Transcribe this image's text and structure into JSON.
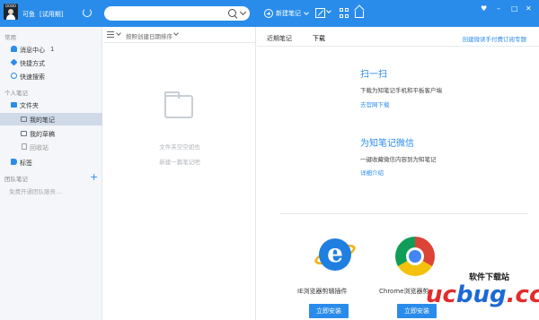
{
  "header": {
    "avatar_caption": "DOBO",
    "username": "可鱼",
    "trial_badge": "[试用期]",
    "search_value": "",
    "new_note_label": "新建笔记",
    "window_controls": [
      "♥",
      "–",
      "□",
      "✕"
    ]
  },
  "sidebar": {
    "section_common": "常用",
    "items_common": [
      {
        "label": "消息中心",
        "count": "1",
        "icon": "bell-icon"
      },
      {
        "label": "快捷方式",
        "icon": "link-icon"
      },
      {
        "label": "快速搜索",
        "icon": "search-icon"
      }
    ],
    "section_personal": "个人笔记",
    "folder_root": "文件夹",
    "folders": [
      {
        "label": "我的笔记",
        "active": true
      },
      {
        "label": "我的草稿",
        "active": false
      },
      {
        "label": "回收站",
        "active": false
      }
    ],
    "tags_label": "标签",
    "section_team": "团队笔记",
    "team_hint": "免费开通团队服务..."
  },
  "notelist": {
    "sort_label": "按照创建日期排序",
    "empty_line1": "文件夹空空如也",
    "empty_line2": "新建一篇笔记吧"
  },
  "main": {
    "tabs": [
      "近期笔记",
      "下载"
    ],
    "active_tab": "下载",
    "top_link": "创建微读手付费订阅专题",
    "scan_title": "扫一扫",
    "scan_desc": "下载为知笔记手机和平板客户端",
    "scan_link": "去官网下载",
    "wechat_title": "为知笔记微信",
    "wechat_desc": "一键收藏微信内容到为知笔记",
    "wechat_link": "详细介绍",
    "plugins": [
      {
        "name": "IE浏览器剪辑插件",
        "button": "立即安装",
        "icon": "ie-logo-icon"
      },
      {
        "name": "Chrome浏览器剪",
        "button": "立即安装",
        "icon": "chrome-logo-icon"
      }
    ]
  },
  "watermark": {
    "top": "软件下载站",
    "big_red": "uc",
    "big_blue": "bug",
    "big_red2": ".cc"
  },
  "colors": {
    "accent": "#2a8cea",
    "sidebar_bg": "#f4f6f9",
    "active_item": "#cfd9e7"
  }
}
